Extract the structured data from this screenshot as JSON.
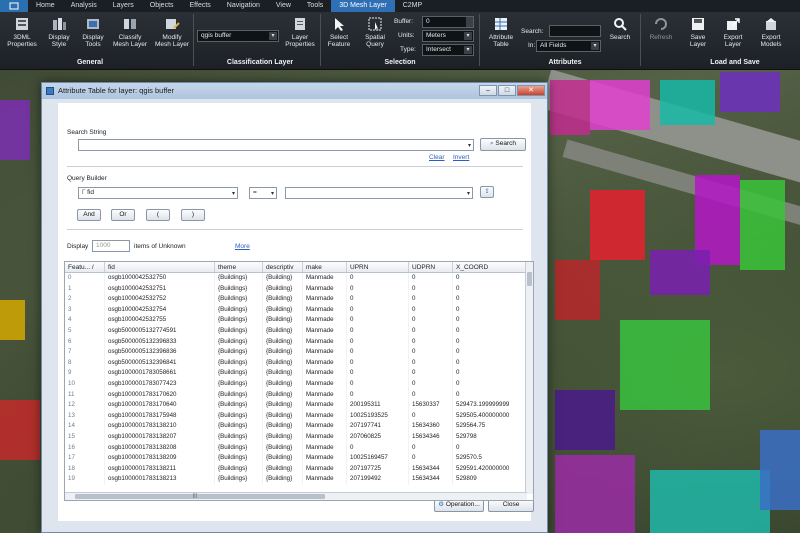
{
  "tabs": [
    "Home",
    "Analysis",
    "Layers",
    "Objects",
    "Effects",
    "Navigation",
    "View",
    "Tools",
    "3D Mesh Layer",
    "C2MP"
  ],
  "active_tab": "3D Mesh Layer",
  "ribbon": {
    "b3dml": "3DML\nProperties",
    "display_style": "Display\nStyle",
    "display_tools": "Display\nTools",
    "classify": "Classify\nMesh Layer",
    "modify": "Modify\nMesh Layer",
    "group_general": "General",
    "class_combo": "qgis buffer",
    "layer_props": "Layer\nProperties",
    "group_class": "Classification Layer",
    "select_feature": "Select\nFeature",
    "spatial_query": "Spatial\nQuery",
    "buffer_label": "Buffer:",
    "buffer_value": "0",
    "units_label": "Units:",
    "units_value": "Meters",
    "type_label": "Type:",
    "type_value": "Intersect",
    "group_selection": "Selection",
    "attr_table": "Attribute\nTable",
    "search_label": "Search:",
    "search_value": "",
    "in_label": "In:",
    "in_value": "All Fields",
    "search_btn": "Search",
    "group_attr": "Attributes",
    "refresh": "Refresh",
    "save_layer": "Save\nLayer",
    "export_layer": "Export\nLayer",
    "export_models": "Export\nModels",
    "group_load": "Load and Save"
  },
  "dialog": {
    "title": "Attribute Table for layer: qgis buffer",
    "search_string_label": "Search String",
    "search_value": "",
    "search_button": "Search",
    "clear": "Clear",
    "invert": "Invert",
    "query_builder_label": "Query Builder",
    "field_value": "fid",
    "operator_value": "=",
    "value_value": "",
    "and": "And",
    "or": "Or",
    "lparen": "(",
    "rparen": ")",
    "display_label": "Display",
    "display_count": "1000",
    "items_of": "items of Unknown",
    "more": "More",
    "operation": "Operation...",
    "close": "Close"
  },
  "table": {
    "columns": [
      "Featu... /",
      "fid",
      "theme",
      "descriptiv",
      "make",
      "UPRN",
      "UDPRN",
      "X_COORD"
    ],
    "rows": [
      [
        "0",
        "osgb1000042532750",
        "{Buildings}",
        "{Building}",
        "Manmade",
        "0",
        "0",
        "0"
      ],
      [
        "1",
        "osgb1000042532751",
        "{Buildings}",
        "{Building}",
        "Manmade",
        "0",
        "0",
        "0"
      ],
      [
        "2",
        "osgb1000042532752",
        "{Buildings}",
        "{Building}",
        "Manmade",
        "0",
        "0",
        "0"
      ],
      [
        "3",
        "osgb1000042532754",
        "{Buildings}",
        "{Building}",
        "Manmade",
        "0",
        "0",
        "0"
      ],
      [
        "4",
        "osgb1000042532755",
        "{Buildings}",
        "{Building}",
        "Manmade",
        "0",
        "0",
        "0"
      ],
      [
        "5",
        "osgb5000005132774591",
        "{Buildings}",
        "{Building}",
        "Manmade",
        "0",
        "0",
        "0"
      ],
      [
        "6",
        "osgb5000005132396833",
        "{Buildings}",
        "{Building}",
        "Manmade",
        "0",
        "0",
        "0"
      ],
      [
        "7",
        "osgb5000005132396836",
        "{Buildings}",
        "{Building}",
        "Manmade",
        "0",
        "0",
        "0"
      ],
      [
        "8",
        "osgb5000005132396841",
        "{Buildings}",
        "{Building}",
        "Manmade",
        "0",
        "0",
        "0"
      ],
      [
        "9",
        "osgb1000001783058661",
        "{Buildings}",
        "{Building}",
        "Manmade",
        "0",
        "0",
        "0"
      ],
      [
        "10",
        "osgb1000001783077423",
        "{Buildings}",
        "{Building}",
        "Manmade",
        "0",
        "0",
        "0"
      ],
      [
        "11",
        "osgb1000001783170620",
        "{Buildings}",
        "{Building}",
        "Manmade",
        "0",
        "0",
        "0"
      ],
      [
        "12",
        "osgb1000001783170640",
        "{Buildings}",
        "{Building}",
        "Manmade",
        "200195311",
        "15630337",
        "529473.199999999"
      ],
      [
        "13",
        "osgb1000001783175948",
        "{Buildings}",
        "{Building}",
        "Manmade",
        "10025193525",
        "0",
        "529505.400000000"
      ],
      [
        "14",
        "osgb1000001783138210",
        "{Buildings}",
        "{Building}",
        "Manmade",
        "207197741",
        "15634360",
        "529564.75"
      ],
      [
        "15",
        "osgb1000001783138207",
        "{Buildings}",
        "{Building}",
        "Manmade",
        "207060825",
        "15634346",
        "529798"
      ],
      [
        "16",
        "osgb1000001783138208",
        "{Buildings}",
        "{Building}",
        "Manmade",
        "0",
        "0",
        "0"
      ],
      [
        "17",
        "osgb1000001783138209",
        "{Buildings}",
        "{Building}",
        "Manmade",
        "10025169457",
        "0",
        "529570.5"
      ],
      [
        "18",
        "osgb1000001783138211",
        "{Buildings}",
        "{Building}",
        "Manmade",
        "207197725",
        "15634344",
        "529591.420000000"
      ],
      [
        "19",
        "osgb1000001783138213",
        "{Buildings}",
        "{Building}",
        "Manmade",
        "207199492",
        "15634344",
        "529809"
      ]
    ]
  },
  "colors": {
    "accent": "#2f6fb6",
    "ribbon_bg": "#1d2126",
    "dialog_bg": "#dfe5ee",
    "link": "#2a5fc0"
  }
}
